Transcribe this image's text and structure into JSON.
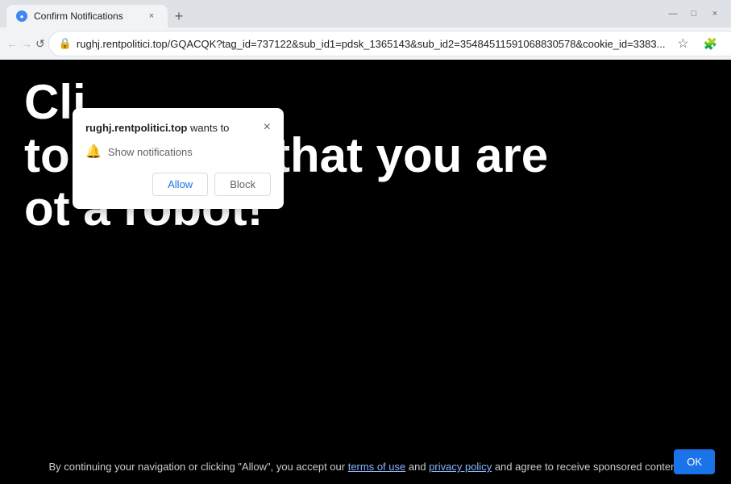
{
  "browser": {
    "tab": {
      "favicon_symbol": "●",
      "title": "Confirm Notifications",
      "close_symbol": "×"
    },
    "new_tab_symbol": "+",
    "window_controls": {
      "minimize": "—",
      "maximize": "□",
      "close": "×"
    },
    "nav": {
      "back_symbol": "←",
      "forward_symbol": "→",
      "reload_symbol": "↺",
      "address": "rughj.rentpolitici.top/GQACQK?tag_id=737122&sub_id1=pdsk_1365143&sub_id2=35484511591068830578&cookie_id=3383...",
      "bookmark_symbol": "☆",
      "extensions_symbol": "🧩",
      "account_symbol": "⊙",
      "menu_symbol": "⋮"
    }
  },
  "page": {
    "headline_part1": "Cli",
    "headline_part2": "to confirm that you are",
    "headline_part3": "ot a robot!"
  },
  "footer": {
    "text_before_links": "By continuing your navigation or clicking \"Allow\", you accept our ",
    "link1_text": "terms of use",
    "text_between": " and ",
    "link2_text": "privacy policy",
    "text_after": " and agree to receive sponsored content.",
    "ok_label": "OK"
  },
  "popup": {
    "site": "rughj.rentpolitici.top",
    "wants_to": " wants to",
    "close_symbol": "×",
    "notification_text": "Show notifications",
    "bell_symbol": "🔔",
    "allow_label": "Allow",
    "block_label": "Block"
  }
}
